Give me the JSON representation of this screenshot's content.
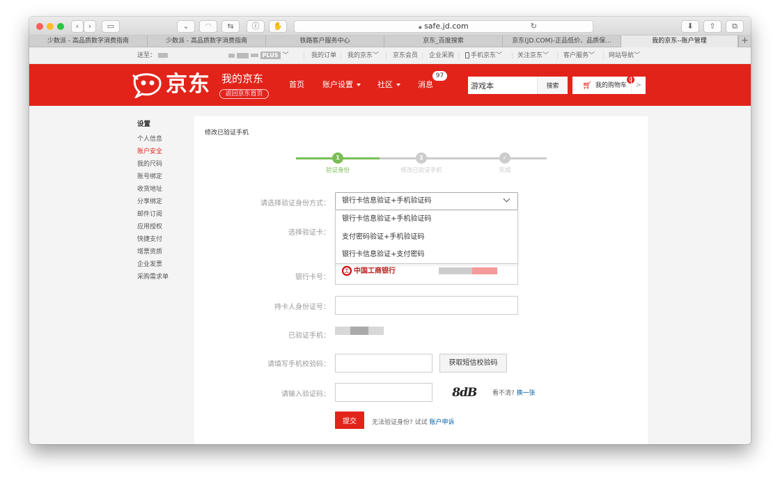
{
  "browser": {
    "url": "safe.jd.com",
    "tabs": [
      {
        "label": "少数派 - 高品质数字消费指南",
        "active": false
      },
      {
        "label": "少数派 - 高品质数字消费指南",
        "active": false
      },
      {
        "label": "铁路客户服务中心",
        "active": false
      },
      {
        "label": "京东_百度搜索",
        "active": false
      },
      {
        "label": "京东(JD.COM)-正品低价、品质保...",
        "active": false
      },
      {
        "label": "我的京东--账户管理",
        "active": true
      }
    ],
    "new_tab": "+"
  },
  "topbar": {
    "send_to": "送至：",
    "plus_badge": "PLUS",
    "links": [
      "我的订单",
      "我的京东",
      "京东会员",
      "企业采购",
      "手机京东",
      "关注京东",
      "客户服务",
      "网站导航"
    ]
  },
  "header": {
    "logo_text": "京东",
    "my_jd": "我的京东",
    "back_home": "返回京东首页",
    "nav": {
      "home": "首页",
      "account": "账户设置",
      "community": "社区",
      "messages": "消息"
    },
    "message_count": "97",
    "search_value": "游戏本",
    "search_button": "搜索",
    "cart_label": "我的购物车",
    "cart_count": "0",
    "cart_arrow": ">"
  },
  "sidebar": {
    "title": "设置",
    "items": [
      "个人信息",
      "账户安全",
      "我的尺码",
      "账号绑定",
      "收货地址",
      "分享绑定",
      "邮件订阅",
      "应用授权",
      "快捷支付",
      "增票资质",
      "企业发票",
      "采购需求单"
    ],
    "active_index": 1
  },
  "main": {
    "title": "修改已验证手机",
    "steps": [
      {
        "number": "1",
        "label": "验证身份"
      },
      {
        "number": "2",
        "label": "修改已验证手机"
      },
      {
        "number": "✓",
        "label": "完成"
      }
    ],
    "form": {
      "method_label": "请选择验证身份方式：",
      "method_selected": "银行卡信息验证+手机验证码",
      "method_options": [
        "银行卡信息验证+手机验证码",
        "支付密码验证+手机验证码",
        "银行卡信息验证+支付密码"
      ],
      "card_label": "选择验证卡：",
      "bank_name": "中国工商银行",
      "card_no_label": "银行卡号：",
      "id_label": "持卡人身份证号：",
      "phone_label": "已验证手机：",
      "sms_label": "请填写手机校验码：",
      "sms_button": "获取短信校验码",
      "captcha_label": "请输入验证码：",
      "captcha_text": "8dB",
      "captcha_hint": "看不清?",
      "captcha_refresh": "换一张",
      "submit": "提交",
      "fallback_text": "无法验证身份? 试试",
      "fallback_link": "账户申诉"
    }
  },
  "colors": {
    "brand_red": "#e2231a",
    "step_green": "#7abd54",
    "step_grey": "#cccccc",
    "link_blue": "#005ea7"
  }
}
